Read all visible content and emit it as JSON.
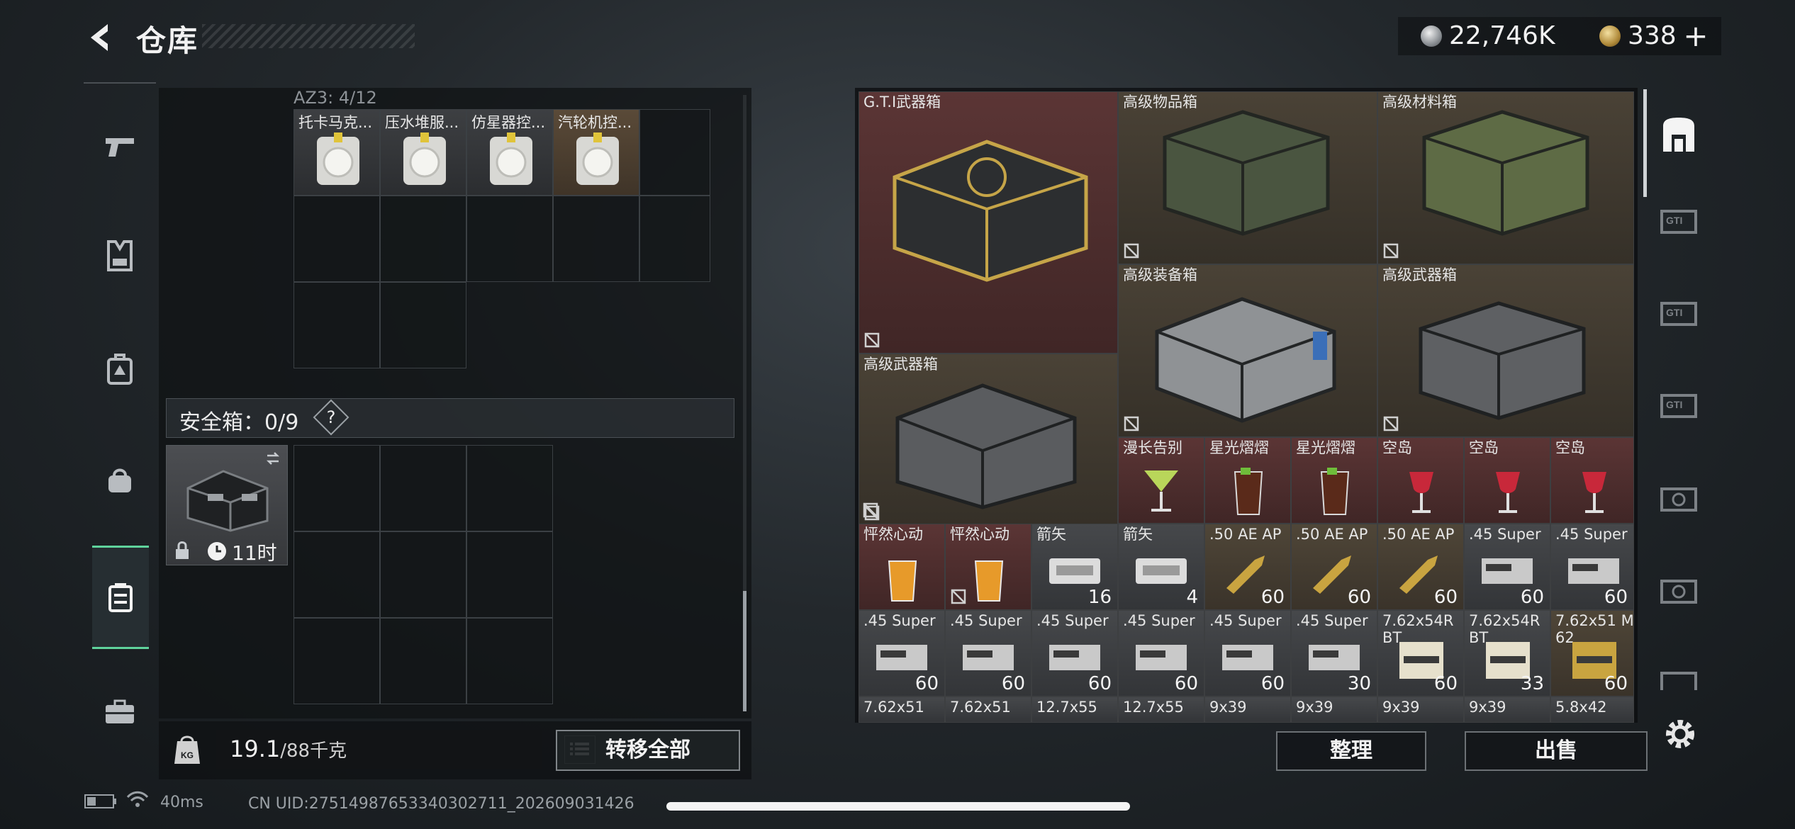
{
  "header": {
    "title": "仓库"
  },
  "currency": {
    "silver": "22,746K",
    "gold": "338"
  },
  "left_sidebar": {
    "items": [
      "pistol-icon",
      "vest-icon",
      "backpack-icon",
      "bag-icon",
      "container-icon",
      "briefcase-icon"
    ],
    "active": "container-icon"
  },
  "storage": {
    "az_label": "AZ3: 4/12",
    "items": [
      {
        "name": "托卡马克..."
      },
      {
        "name": "压水堆服..."
      },
      {
        "name": "仿星器控..."
      },
      {
        "name": "汽轮机控..."
      }
    ]
  },
  "safe": {
    "label": "安全箱：0/9",
    "help": "?",
    "timer": "11时"
  },
  "weight": {
    "current": "19.1",
    "max": "/88千克"
  },
  "buttons": {
    "transfer_all": "转移全部",
    "sort": "整理",
    "sell": "出售"
  },
  "inventory": {
    "big": [
      {
        "name": "G.T.I武器箱"
      },
      {
        "name": "高级物品箱"
      },
      {
        "name": "高级材料箱"
      },
      {
        "name": "高级装备箱"
      },
      {
        "name": "高级武器箱"
      },
      {
        "name": "高级武器箱"
      }
    ],
    "row_drinks": [
      {
        "name": "漫长告别"
      },
      {
        "name": "星光熠熠"
      },
      {
        "name": "星光熠熠"
      },
      {
        "name": "空岛"
      },
      {
        "name": "空岛"
      },
      {
        "name": "空岛"
      }
    ],
    "row_ammo1": [
      {
        "name": "怦然心动",
        "count": ""
      },
      {
        "name": "怦然心动",
        "count": ""
      },
      {
        "name": "箭矢",
        "count": "16"
      },
      {
        "name": "箭矢",
        "count": "4"
      },
      {
        "name": ".50 AE AP",
        "count": "60"
      },
      {
        "name": ".50 AE AP",
        "count": "60"
      },
      {
        "name": ".50 AE AP",
        "count": "60"
      },
      {
        "name": ".45 Super",
        "count": "60"
      },
      {
        "name": ".45 Super",
        "count": "60"
      }
    ],
    "row_ammo2": [
      {
        "name": ".45 Super",
        "count": "60"
      },
      {
        "name": ".45 Super",
        "count": "60"
      },
      {
        "name": ".45 Super",
        "count": "60"
      },
      {
        "name": ".45 Super",
        "count": "60"
      },
      {
        "name": ".45 Super",
        "count": "60"
      },
      {
        "name": ".45 Super",
        "count": "30"
      },
      {
        "name": "7.62x54R BT",
        "count": "60"
      },
      {
        "name": "7.62x54R BT",
        "count": "33"
      },
      {
        "name": "7.62x51 M62",
        "count": "60"
      }
    ],
    "row_ammo3": [
      {
        "name": "7.62x51"
      },
      {
        "name": "7.62x51"
      },
      {
        "name": "12.7x55"
      },
      {
        "name": "12.7x55"
      },
      {
        "name": "9x39"
      },
      {
        "name": "9x39"
      },
      {
        "name": "9x39"
      },
      {
        "name": "9x39"
      },
      {
        "name": "5.8x42"
      }
    ]
  },
  "status": {
    "ping": "40ms",
    "uid": "CN UID:27514987653340302711_202609031426"
  },
  "colors": {
    "accent": "#5fd39c",
    "cell_red": "#4d2e2e",
    "cell_brown": "#403a30"
  }
}
